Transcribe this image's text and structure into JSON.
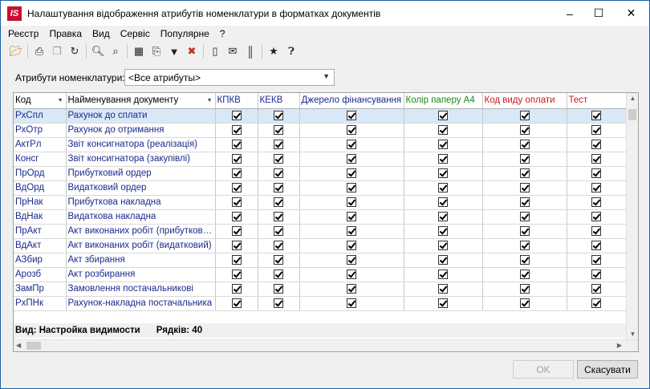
{
  "window": {
    "title": "Налаштування відображення атрибутів номенклатури в форматках документів",
    "app_badge": "IS",
    "controls": {
      "minimize": "–",
      "maximize": "☐",
      "close": "✕"
    }
  },
  "menu": [
    "Реєстр",
    "Правка",
    "Вид",
    "Сервіс",
    "Популярне",
    "?"
  ],
  "toolbar": {
    "icons": [
      "open-icon",
      "print-icon",
      "copy-icon",
      "refresh-icon",
      "find-icon",
      "find-next-icon",
      "table-icon",
      "export-icon",
      "filter-icon",
      "clear-filter-icon",
      "page-icon",
      "mail-icon",
      "barcode-icon",
      "favorite-icon",
      "help-icon"
    ]
  },
  "filter": {
    "label": "Атрибути номенклатури:",
    "value": "<Все атрибуты>"
  },
  "grid": {
    "columns": [
      "Код",
      "Найменування документу",
      "КПКВ",
      "КЕКВ",
      "Джерело фінансування",
      "Колір паперу А4",
      "Код виду оплати",
      "Тест"
    ],
    "column_colors": [
      "#000000",
      "#000000",
      "#1a2a8c",
      "#1a2a8c",
      "#1a2a8c",
      "#178a17",
      "#d01818",
      "#d01818"
    ],
    "rows": [
      {
        "code": "РхСпл",
        "name": "Рахунок до сплати"
      },
      {
        "code": "РхОтр",
        "name": "Рахунок до отримання"
      },
      {
        "code": "АктРл",
        "name": "Звіт консигнатора (реалізація)"
      },
      {
        "code": "Консг",
        "name": "Звіт консигнатора (закупівлі)"
      },
      {
        "code": "ПрОрд",
        "name": "Прибутковий ордер"
      },
      {
        "code": "ВдОрд",
        "name": "Видатковий ордер"
      },
      {
        "code": "ПрНак",
        "name": "Прибуткова накладна"
      },
      {
        "code": "ВдНак",
        "name": "Видаткова накладна"
      },
      {
        "code": "ПрАкт",
        "name": "Акт виконаних робіт (прибуткови..."
      },
      {
        "code": "ВдАкт",
        "name": "Акт виконаних робіт (видатковий)"
      },
      {
        "code": "АЗбир",
        "name": "Акт збирання"
      },
      {
        "code": "Арозб",
        "name": "Акт розбирання"
      },
      {
        "code": "ЗамПр",
        "name": "Замовлення постачальникові"
      },
      {
        "code": "РхПНк",
        "name": "Рахунок-накладна постачальника"
      }
    ],
    "selected_row": 0
  },
  "status": {
    "view": "Вид: Настройка видимости",
    "rows": "Рядків: 40"
  },
  "buttons": {
    "ok": "OK",
    "cancel": "Скасувати"
  }
}
